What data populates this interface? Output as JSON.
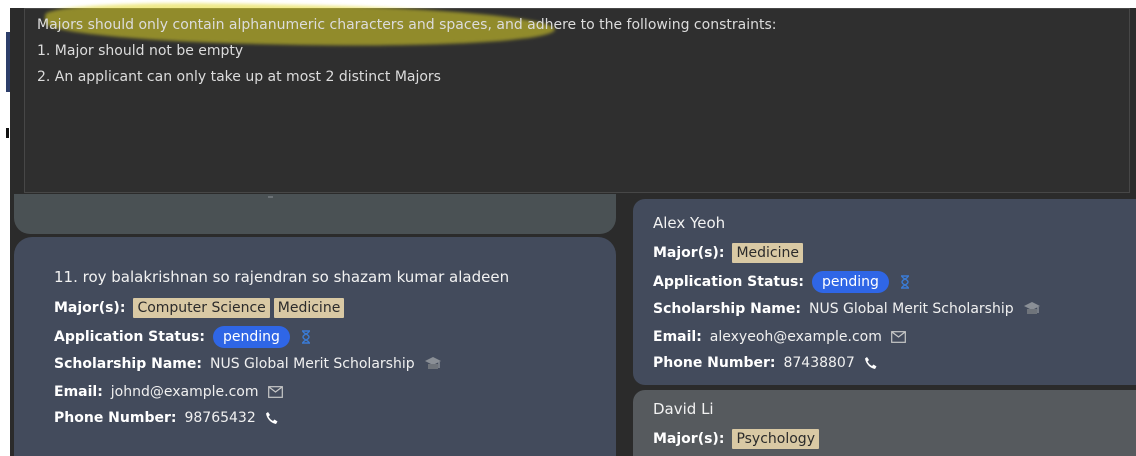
{
  "validation": {
    "message": "Majors should only contain alphanumeric characters and spaces, and adhere to the following constraints:",
    "constraint_1": "1. Major should not be empty",
    "constraint_2": "2. An applicant can only take up at most 2 distinct Majors",
    "highlight_color": "#e1d728"
  },
  "labels": {
    "majors": "Major(s):",
    "status": "Application Status:",
    "scholarship": "Scholarship Name:",
    "email": "Email:",
    "phone": "Phone Number:"
  },
  "left_card": {
    "index_name": "11.  roy balakrishnan so rajendran so shazam kumar aladeen",
    "majors": [
      "Computer Science",
      "Medicine"
    ],
    "status": "pending",
    "scholarship": "NUS Global Merit Scholarship",
    "email": "johnd@example.com",
    "phone": "98765432"
  },
  "right_cards": [
    {
      "name": "Alex Yeoh",
      "majors": [
        "Medicine"
      ],
      "status": "pending",
      "scholarship": "NUS Global Merit Scholarship",
      "email": "alexyeoh@example.com",
      "phone": "87438807"
    },
    {
      "name": "David Li",
      "majors": [
        "Psychology"
      ]
    }
  ],
  "colors": {
    "card_bg": "#434b5c",
    "tag_bg": "#d9c9a4",
    "status_pill": "#2f66e6",
    "app_bg": "#2b2b2b"
  },
  "icons": [
    "hourglass-icon",
    "scholarship-icon",
    "mail-icon",
    "phone-icon"
  ]
}
